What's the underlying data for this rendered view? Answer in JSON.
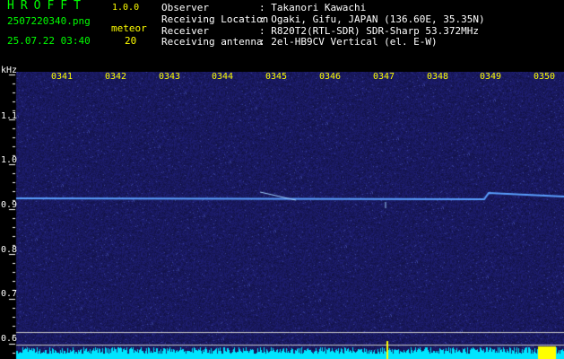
{
  "app": {
    "name": "HROFFT",
    "version": "1.0.0"
  },
  "file": {
    "name": "2507220340.png",
    "datetime": "25.07.22 03:40"
  },
  "meteor": {
    "label": "meteor",
    "count": "20"
  },
  "station": {
    "rows": [
      {
        "label": "Observer",
        "value": ": Takanori Kawachi"
      },
      {
        "label": "Receiving Location",
        "value": ": Ogaki, Gifu, JAPAN (136.60E, 35.35N)"
      },
      {
        "label": "Receiver",
        "value": ": R820T2(RTL-SDR) SDR-Sharp 53.372MHz"
      },
      {
        "label": "Receiving antenna",
        "value": ": 2el-HB9CV Vertical (el. E-W)"
      }
    ]
  },
  "axes": {
    "y_unit": "kHz",
    "x_ticks": [
      "0341",
      "0342",
      "0343",
      "0344",
      "0345",
      "0346",
      "0347",
      "0348",
      "0349",
      "0350"
    ],
    "y_ticks": [
      "1.1",
      "1.0",
      "0.9",
      "0.8",
      "0.7",
      "0.6"
    ]
  },
  "colors": {
    "background": "#000000",
    "spectrogram_base": "#161660",
    "signal_line": "#5aa0ff",
    "text_green": "#00ff00",
    "text_yellow": "#ffff00",
    "text_white": "#ffffff",
    "bottom_bar": "#00e5ff"
  }
}
